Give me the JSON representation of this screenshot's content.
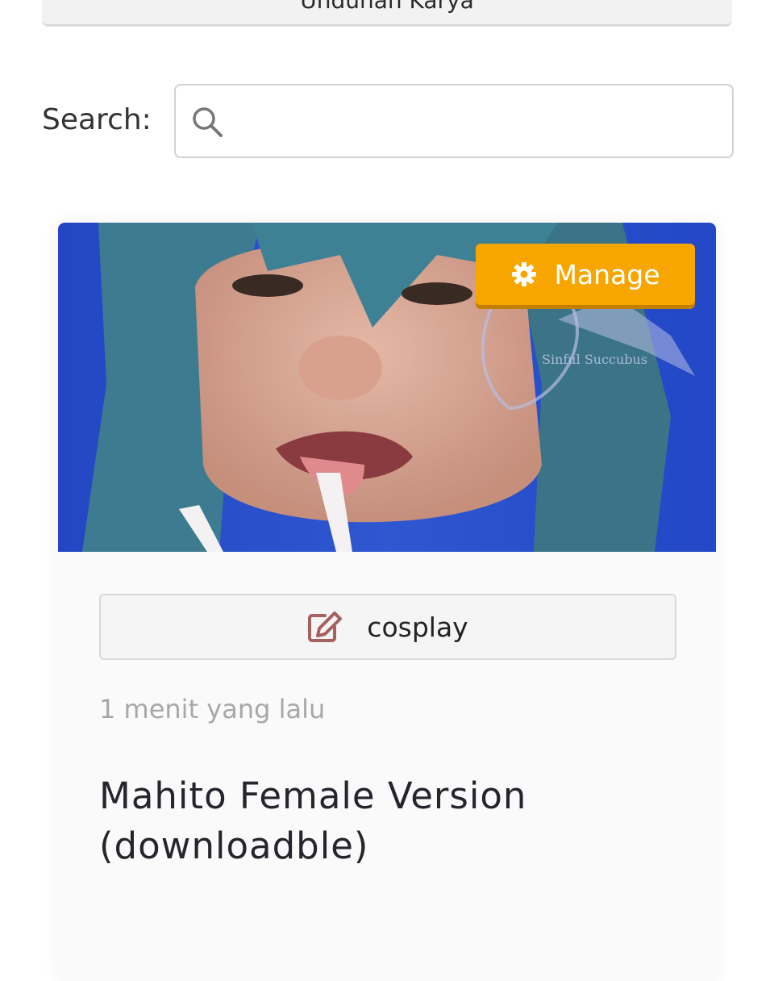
{
  "top_bar": {
    "label": "Unduhan Karya"
  },
  "search": {
    "label": "Search:",
    "value": "",
    "placeholder": ""
  },
  "card": {
    "manage_label": "Manage",
    "category_label": "cosplay",
    "timestamp": "1 menit yang lalu",
    "title": "Mahito Female Version (downloadble)",
    "watermark": "Sinful Succubus"
  },
  "icons": {
    "search": "search-icon",
    "manage": "gear-icon",
    "category": "edit-icon"
  },
  "colors": {
    "accent": "#f7a600",
    "category_icon": "#a4615e",
    "timestamp": "#a8a8a8"
  }
}
